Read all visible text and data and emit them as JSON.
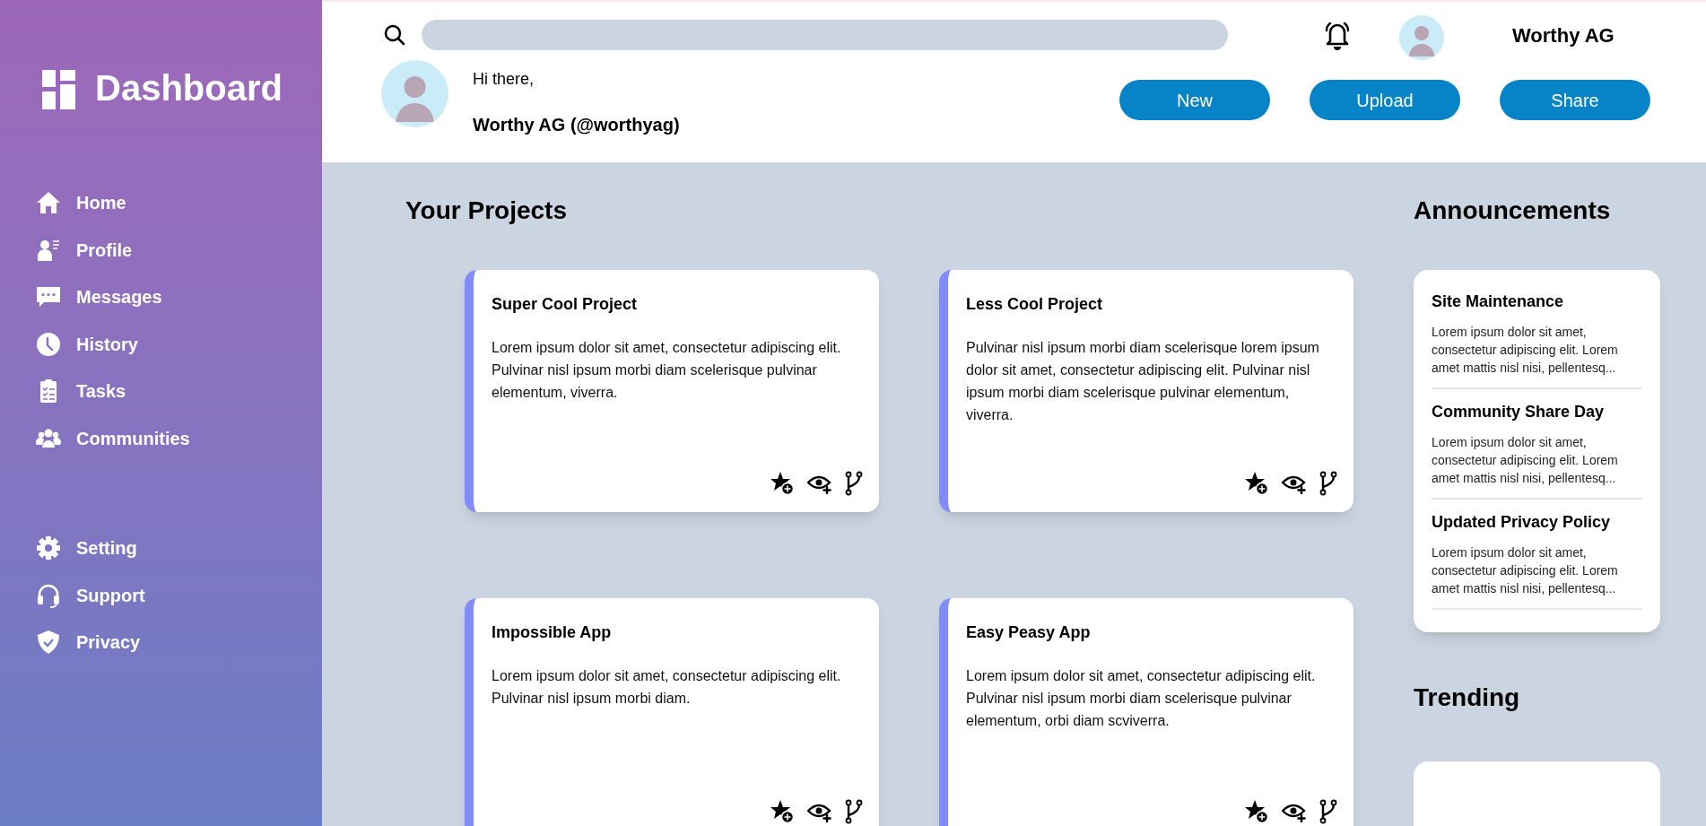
{
  "sidebar": {
    "title": "Dashboard",
    "nav_items": [
      {
        "label": "Home"
      },
      {
        "label": "Profile"
      },
      {
        "label": "Messages"
      },
      {
        "label": "History"
      },
      {
        "label": "Tasks"
      },
      {
        "label": "Communities"
      }
    ],
    "bottom_items": [
      {
        "label": "Setting"
      },
      {
        "label": "Support"
      },
      {
        "label": "Privacy"
      }
    ]
  },
  "header": {
    "user_name": "Worthy AG",
    "greeting": "Hi there,",
    "display_name": "Worthy AG (@worthyag)",
    "buttons": [
      "New",
      "Upload",
      "Share"
    ]
  },
  "projects": {
    "title": "Your Projects",
    "cards": [
      {
        "title": "Super Cool Project",
        "description": "Lorem ipsum dolor sit amet, consectetur adipiscing elit. Pulvinar nisl ipsum morbi diam scelerisque pulvinar elementum, viverra."
      },
      {
        "title": "Less Cool Project",
        "description": "Pulvinar nisl ipsum morbi diam scelerisque lorem ipsum dolor sit amet, consectetur adipiscing elit. Pulvinar nisl ipsum morbi diam scelerisque pulvinar elementum, viverra."
      },
      {
        "title": "Impossible App",
        "description": "Lorem ipsum dolor sit amet, consectetur adipiscing elit. Pulvinar nisl ipsum morbi diam."
      },
      {
        "title": "Easy Peasy App",
        "description": "Lorem ipsum dolor sit amet, consectetur adipiscing elit. Pulvinar nisl ipsum morbi diam scelerisque pulvinar elementum, orbi diam scviverra."
      }
    ]
  },
  "announcements": {
    "title": "Announcements",
    "items": [
      {
        "title": "Site Maintenance",
        "text": "Lorem ipsum dolor sit amet, consectetur adipiscing elit. Lorem amet mattis nisl nisi, pellentesq..."
      },
      {
        "title": "Community Share Day",
        "text": "Lorem ipsum dolor sit amet, consectetur adipiscing elit. Lorem amet mattis nisl nisi, pellentesq..."
      },
      {
        "title": "Updated Privacy Policy",
        "text": "Lorem ipsum dolor sit amet, consectetur adipiscing elit. Lorem amet mattis nisl nisi, pellentesq..."
      }
    ]
  },
  "trending": {
    "title": "Trending"
  }
}
